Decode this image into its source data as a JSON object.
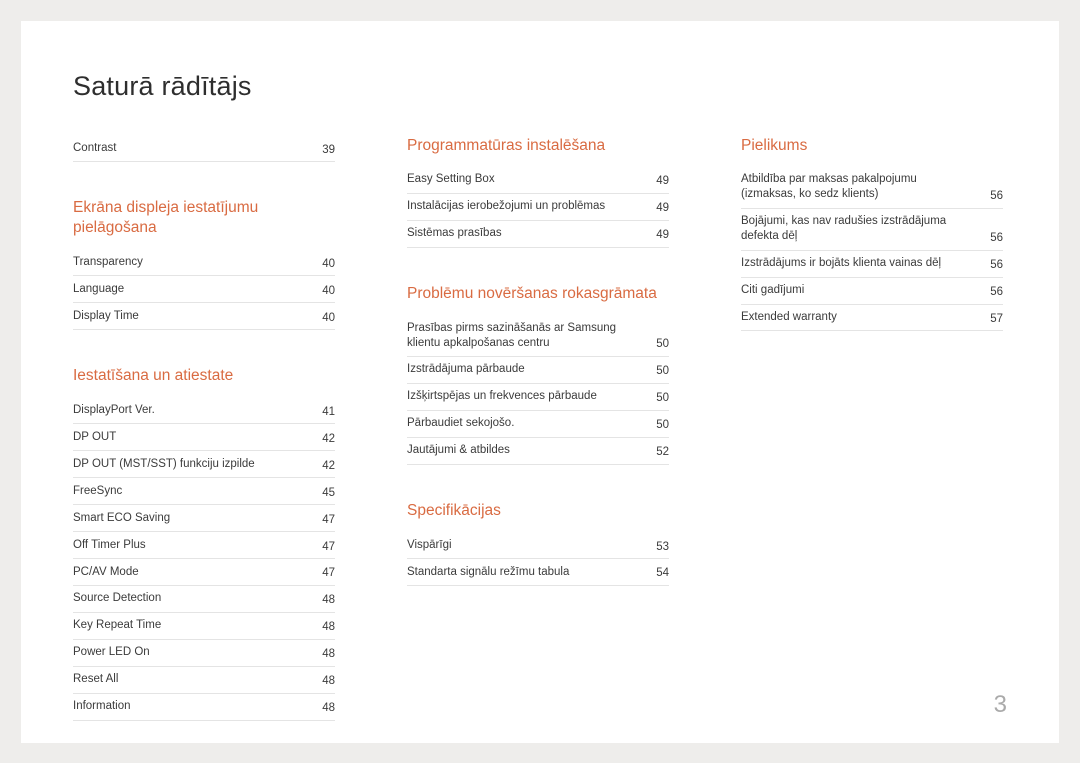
{
  "title": "Saturā rādītājs",
  "page_number": "3",
  "columns": [
    {
      "blocks": [
        {
          "heading": null,
          "rows": [
            {
              "label": "Contrast",
              "page": "39"
            }
          ]
        },
        {
          "heading": "Ekrāna displeja iestatījumu pielāgošana",
          "rows": [
            {
              "label": "Transparency",
              "page": "40"
            },
            {
              "label": "Language",
              "page": "40"
            },
            {
              "label": "Display Time",
              "page": "40"
            }
          ]
        },
        {
          "heading": "Iestatīšana un atiestate",
          "rows": [
            {
              "label": "DisplayPort Ver.",
              "page": "41"
            },
            {
              "label": "DP OUT",
              "page": "42"
            },
            {
              "label": "DP OUT (MST/SST) funkciju izpilde",
              "page": "42"
            },
            {
              "label": "FreeSync",
              "page": "45"
            },
            {
              "label": "Smart ECO Saving",
              "page": "47"
            },
            {
              "label": "Off Timer Plus",
              "page": "47"
            },
            {
              "label": "PC/AV Mode",
              "page": "47"
            },
            {
              "label": "Source Detection",
              "page": "48"
            },
            {
              "label": "Key Repeat Time",
              "page": "48"
            },
            {
              "label": "Power LED On",
              "page": "48"
            },
            {
              "label": "Reset All",
              "page": "48"
            },
            {
              "label": "Information",
              "page": "48"
            }
          ]
        }
      ]
    },
    {
      "blocks": [
        {
          "heading": "Programmatūras instalēšana",
          "rows": [
            {
              "label": "Easy Setting Box",
              "page": "49"
            },
            {
              "label": "Instalācijas ierobežojumi un problēmas",
              "page": "49"
            },
            {
              "label": "Sistēmas prasības",
              "page": "49"
            }
          ]
        },
        {
          "heading": "Problēmu novēršanas rokasgrāmata",
          "rows": [
            {
              "label": "Prasības pirms sazināšanās ar Samsung klientu apkalpošanas centru",
              "page": "50"
            },
            {
              "label": "Izstrādājuma pārbaude",
              "page": "50"
            },
            {
              "label": "Izšķirtspējas un frekvences pārbaude",
              "page": "50"
            },
            {
              "label": "Pārbaudiet sekojošo.",
              "page": "50"
            },
            {
              "label": "Jautājumi & atbildes",
              "page": "52"
            }
          ]
        },
        {
          "heading": "Specifikācijas",
          "rows": [
            {
              "label": "Vispārīgi",
              "page": "53"
            },
            {
              "label": "Standarta signālu režīmu tabula",
              "page": "54"
            }
          ]
        }
      ]
    },
    {
      "blocks": [
        {
          "heading": "Pielikums",
          "rows": [
            {
              "label": "Atbildība par maksas pakalpojumu (izmaksas, ko sedz klients)",
              "page": "56"
            },
            {
              "label": "Bojājumi, kas nav radušies izstrādājuma defekta dēļ",
              "page": "56"
            },
            {
              "label": "Izstrādājums ir bojāts klienta vainas dēļ",
              "page": "56"
            },
            {
              "label": "Citi gadījumi",
              "page": "56"
            },
            {
              "label": "Extended warranty",
              "page": "57"
            }
          ]
        }
      ]
    }
  ]
}
